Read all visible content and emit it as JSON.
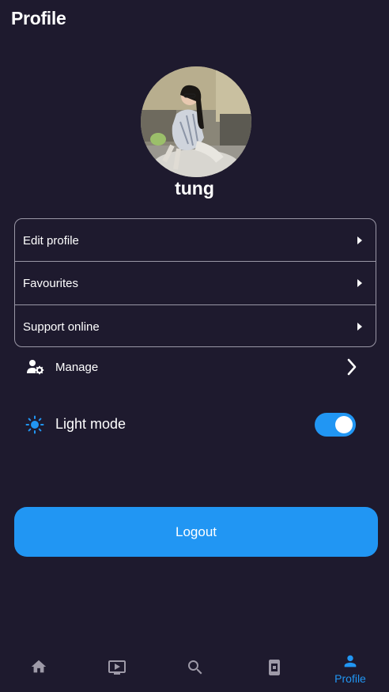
{
  "header": {
    "title": "Profile"
  },
  "profile": {
    "username": "tung"
  },
  "menu": {
    "items": [
      {
        "label": "Edit profile"
      },
      {
        "label": "Favourites"
      },
      {
        "label": "Support online"
      }
    ]
  },
  "manage": {
    "label": "Manage",
    "icon": "manage-user-icon"
  },
  "light_mode": {
    "label": "Light mode",
    "enabled": true,
    "icon": "sun-icon"
  },
  "logout": {
    "label": "Logout"
  },
  "bottom_nav": {
    "items": [
      {
        "icon": "home-icon",
        "label": ""
      },
      {
        "icon": "play-icon",
        "label": ""
      },
      {
        "icon": "search-icon",
        "label": ""
      },
      {
        "icon": "book-icon",
        "label": ""
      },
      {
        "icon": "person-icon",
        "label": "Profile",
        "active": true
      }
    ]
  },
  "colors": {
    "background": "#1e1a2e",
    "accent": "#2196f3",
    "inactive_icon": "#9e9aa8",
    "border": "#9a97a6"
  }
}
